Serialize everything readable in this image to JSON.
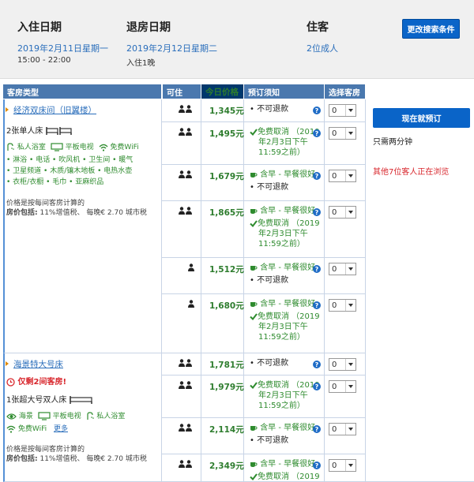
{
  "search": {
    "checkin_label": "入住日期",
    "checkin_date": "2019年2月11日星期一",
    "checkin_time": "15:00 - 22:00",
    "checkout_label": "退房日期",
    "checkout_date": "2019年2月12日星期二",
    "stay": "入住1晚",
    "guests_label": "住客",
    "guests_value": "2位成人",
    "change_button": "更改搜索条件"
  },
  "table_headers": {
    "room_type": "客房类型",
    "occupancy": "可住",
    "price": "今日价格",
    "policy": "预订须知",
    "select": "选择客房"
  },
  "room1": {
    "name": "经济双床间（旧翼楼）",
    "beds": "2张单人床",
    "facilities_row1": [
      "私人浴室",
      "平板电视",
      "免费WiFi"
    ],
    "facilities_row2": "• 淋浴 • 电话 • 吹风机 • 卫生间 • 暖气",
    "facilities_row3": "• 卫星频道 • 木质/镶木地板 • 电热水壶",
    "facilities_row4": "• 衣柜/衣橱 • 毛巾 • 亚麻织品",
    "price_note": "价格是按每间客房计算的",
    "price_incl_label": "房价包括:",
    "price_incl_value": "11%增值税、 每晚€ 2.70 城市税"
  },
  "room2": {
    "name": "海景特大号床",
    "alert": "仅剩2间客房!",
    "beds": "1张超大号双人床",
    "facilities_row1": [
      "海景",
      "平板电视",
      "私人浴室"
    ],
    "facilities_row2_a": "免费WiFi",
    "facilities_row2_more": "更多",
    "price_note": "价格是按每间客房计算的",
    "price_incl_label": "房价包括:",
    "price_incl_value": "11%增值税、 每晚€ 2.70 城市税"
  },
  "rates": [
    {
      "guests": 2,
      "price": "1,345元",
      "breakfast": "",
      "cancel": "",
      "nonrefund": "不可退款"
    },
    {
      "guests": 2,
      "price": "1,495元",
      "breakfast": "",
      "cancel": "免费取消 （2019年2月3日下午11:59之前）",
      "nonrefund": ""
    },
    {
      "guests": 2,
      "price": "1,679元",
      "breakfast": "含早 - 早餐很好",
      "cancel": "",
      "nonrefund": "不可退款"
    },
    {
      "guests": 2,
      "price": "1,865元",
      "breakfast": "含早 - 早餐很好",
      "cancel": "免费取消 （2019年2月3日下午11:59之前）",
      "nonrefund": ""
    },
    {
      "guests": 1,
      "price": "1,512元",
      "breakfast": "含早 - 早餐很好",
      "cancel": "",
      "nonrefund": "不可退款"
    },
    {
      "guests": 1,
      "price": "1,680元",
      "breakfast": "含早 - 早餐很好",
      "cancel": "免费取消 （2019年2月3日下午11:59之前）",
      "nonrefund": ""
    },
    {
      "guests": 2,
      "price": "1,781元",
      "breakfast": "",
      "cancel": "",
      "nonrefund": "不可退款"
    },
    {
      "guests": 2,
      "price": "1,979元",
      "breakfast": "",
      "cancel": "免费取消 （2019年2月3日下午11:59之前）",
      "nonrefund": ""
    },
    {
      "guests": 2,
      "price": "2,114元",
      "breakfast": "含早 - 早餐很好",
      "cancel": "",
      "nonrefund": "不可退款"
    },
    {
      "guests": 2,
      "price": "2,349元",
      "breakfast": "含早 - 早餐很好",
      "cancel": "免费取消 （2019",
      "nonrefund": ""
    }
  ],
  "cancel_lines": [
    "免费取消 （2019",
    "年2月3日下午",
    "11:59之前）"
  ],
  "select_value": "0",
  "sidebar": {
    "book_button": "现在就预订",
    "note": "只需两分钟",
    "viewers": "其他7位客人正在浏览"
  },
  "colors": {
    "link_blue": "#2a6ebb",
    "price_green": "#2e7d2e",
    "button_blue": "#0a64c8",
    "header_blue": "#4a78ae",
    "alert_red": "#d8262c"
  }
}
